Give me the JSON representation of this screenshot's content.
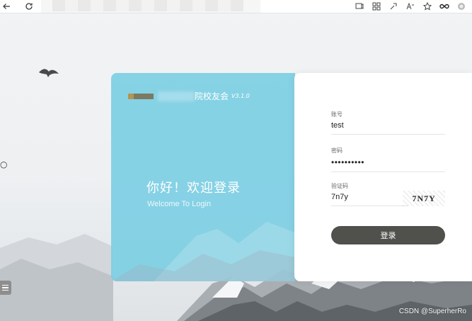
{
  "brand": {
    "title": "院校友会",
    "version": "V3.1.0"
  },
  "welcome": {
    "heading": "你好！欢迎登录",
    "subheading": "Welcome To Login"
  },
  "form": {
    "account_label": "账号",
    "account_value": "test",
    "password_label": "密码",
    "password_value": "••••••••••",
    "captcha_label": "验证码",
    "captcha_value": "7n7y",
    "captcha_image_text": "7N7Y",
    "login_button": "登录"
  },
  "watermark": "CSDN @SuperherRo",
  "colors": {
    "card_left": "#78cde2",
    "login_button": "#50504c"
  },
  "icons": [
    "back-icon",
    "refresh-icon",
    "read-aloud-icon",
    "apps-icon",
    "extensions-icon",
    "text-size-icon",
    "favorite-icon",
    "infinity-icon",
    "profile-icon",
    "menu-icon"
  ]
}
